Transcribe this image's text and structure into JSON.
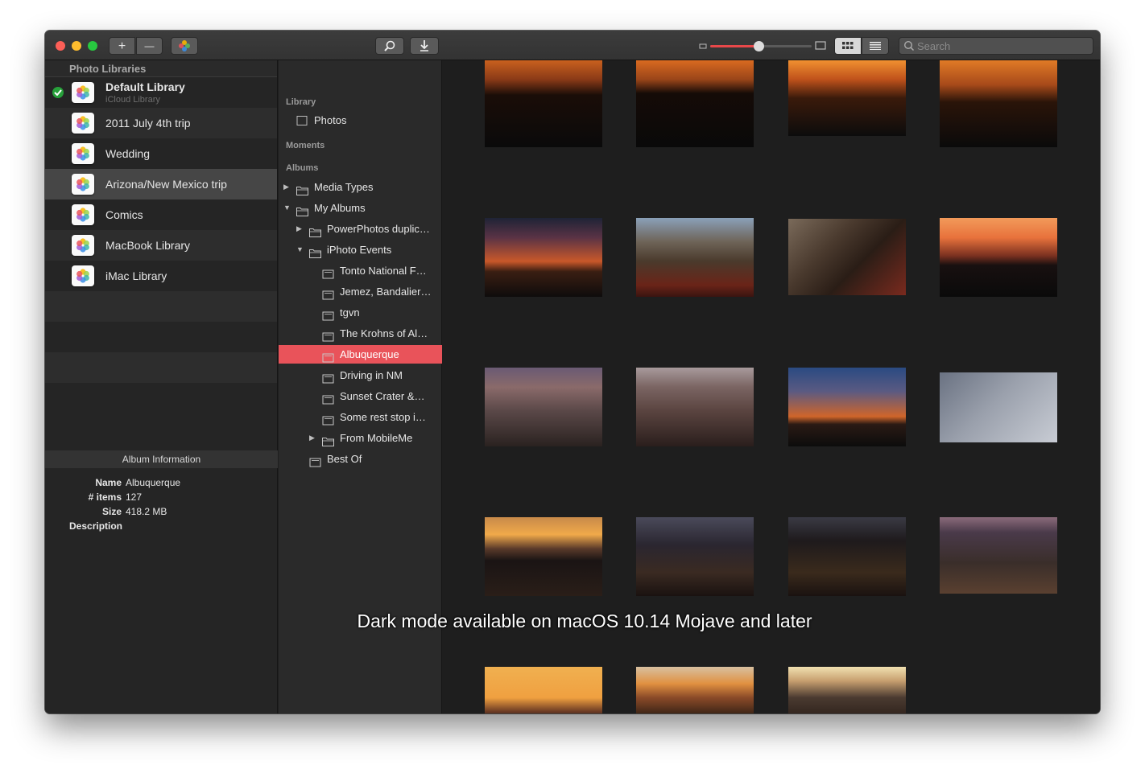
{
  "toolbar": {
    "add_label": "+",
    "remove_label": "—",
    "search_placeholder": "Search"
  },
  "zoom_level": 0.48,
  "view_mode": "grid",
  "libraries": {
    "header": "Photo Libraries",
    "items": [
      {
        "name": "Default Library",
        "sub": "iCloud Library",
        "checked": true
      },
      {
        "name": "2011 July 4th trip"
      },
      {
        "name": "Wedding"
      },
      {
        "name": "Arizona/New Mexico trip",
        "selected": true
      },
      {
        "name": "Comics"
      },
      {
        "name": "MacBook Library"
      },
      {
        "name": "iMac Library"
      }
    ]
  },
  "album_info": {
    "header": "Album Information",
    "name_key": "Name",
    "name_val": "Albuquerque",
    "items_key": "# items",
    "items_val": "127",
    "size_key": "Size",
    "size_val": "418.2 MB",
    "desc_key": "Description"
  },
  "sidebar": {
    "library_header": "Library",
    "photos": "Photos",
    "moments_header": "Moments",
    "albums_header": "Albums",
    "rows": [
      {
        "label": "Media Types",
        "arrow": "▶",
        "level": 0
      },
      {
        "label": "My Albums",
        "arrow": "▼",
        "level": 0
      },
      {
        "label": "PowerPhotos duplic…",
        "arrow": "▶",
        "level": 1
      },
      {
        "label": "iPhoto Events",
        "arrow": "▼",
        "level": 1
      },
      {
        "label": "Tonto National F…",
        "arrow": "",
        "level": 2
      },
      {
        "label": "Jemez, Bandalier…",
        "arrow": "",
        "level": 2
      },
      {
        "label": "tgvn",
        "arrow": "",
        "level": 2
      },
      {
        "label": "The Krohns of Al…",
        "arrow": "",
        "level": 2
      },
      {
        "label": "Albuquerque",
        "arrow": "",
        "level": 2,
        "selected": true
      },
      {
        "label": "Driving in NM",
        "arrow": "",
        "level": 2
      },
      {
        "label": "Sunset Crater &…",
        "arrow": "",
        "level": 2
      },
      {
        "label": "Some rest stop i…",
        "arrow": "",
        "level": 2
      },
      {
        "label": "From MobileMe",
        "arrow": "▶",
        "level": 2
      },
      {
        "label": "Best Of",
        "arrow": "",
        "level": 1
      }
    ]
  },
  "colors": {
    "accent": "#e9535a",
    "window_bg": "#1e1e1e",
    "sidebar_bg": "#252525"
  },
  "caption": "Dark mode available on macOS 10.14 Mojave and later"
}
